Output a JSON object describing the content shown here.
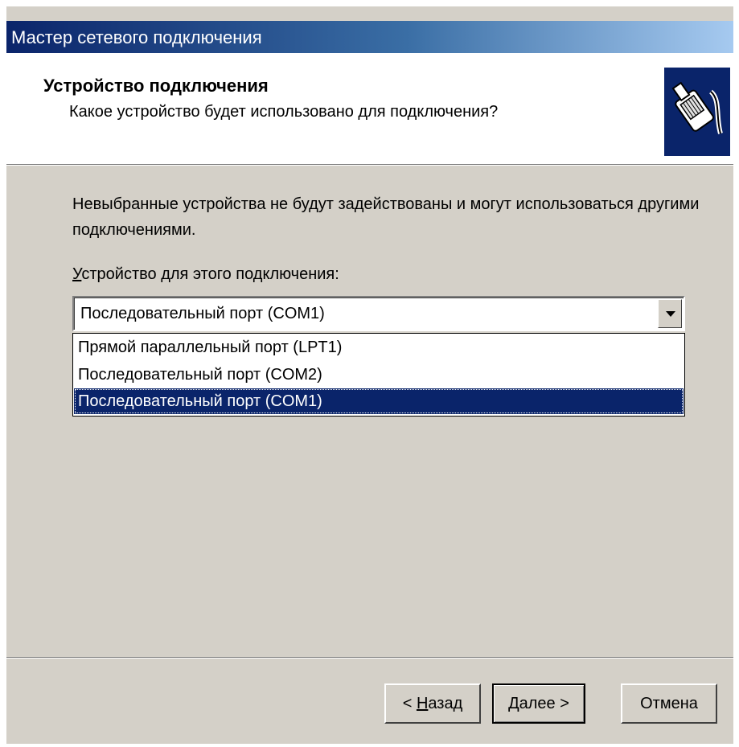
{
  "window": {
    "title": "Мастер сетевого подключения"
  },
  "header": {
    "title": "Устройство подключения",
    "subtitle": "Какое устройство будет использовано для подключения?",
    "icon": "network-cable-plug-icon"
  },
  "body": {
    "info_text": "Невыбранные устройства не будут задействованы и могут использоваться другими подключениями.",
    "device_label_access_key": "У",
    "device_label_rest": "стройство для этого подключения:",
    "device_selected": "Последовательный порт (COM1)",
    "device_options": [
      "Прямой параллельный порт (LPT1)",
      "Последовательный порт (COM2)",
      "Последовательный порт (COM1)"
    ],
    "highlighted_option_index": 2
  },
  "buttons": {
    "back_prefix": "< ",
    "back_key": "Н",
    "back_rest": "азад",
    "next_label": "Далее >",
    "cancel_label": "Отмена"
  },
  "colors": {
    "title_gradient_start": "#0a246a",
    "selection": "#0a246a",
    "face": "#d4d0c8"
  }
}
